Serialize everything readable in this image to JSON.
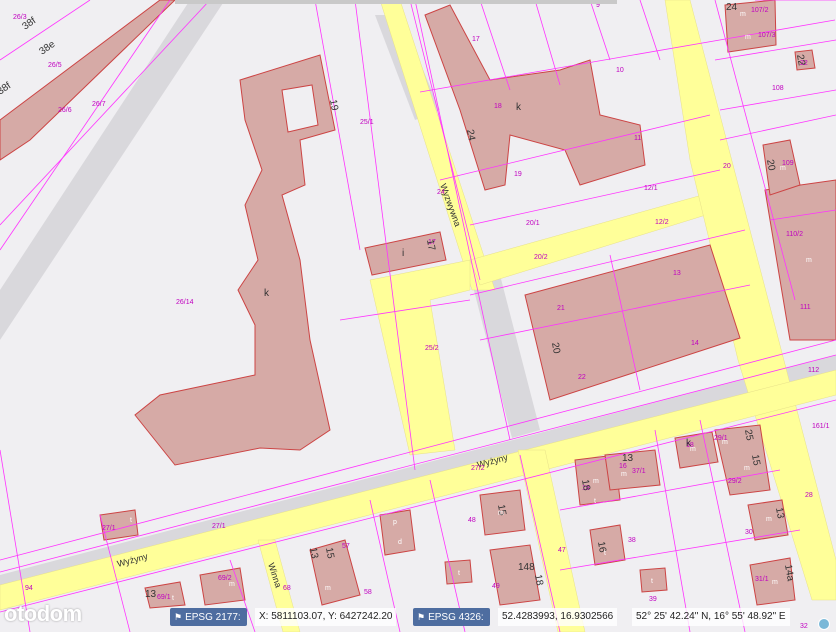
{
  "map": {
    "colors": {
      "background": "#f0eff2",
      "road": "#ffff99",
      "building": "#d6aaa6",
      "parcel_line": "#ff00ff",
      "building_outline": "#cc3333"
    },
    "streets": [
      {
        "id": "vertical",
        "name": "Wyzwywna"
      },
      {
        "id": "horizontal-1",
        "name": "Wyżyny"
      },
      {
        "id": "horizontal-2",
        "name": "Wyżyny"
      },
      {
        "id": "lower",
        "name": "Winna"
      }
    ],
    "parcel_labels": [
      "26/3",
      "26/5",
      "26/6",
      "26/7",
      "9",
      "17",
      "10",
      "107/2",
      "107/3",
      "22",
      "108",
      "11",
      "18",
      "19",
      "24",
      "109",
      "20",
      "25/1",
      "12/1",
      "12/2",
      "20/1",
      "20/2",
      "110/2",
      "111",
      "26/14",
      "17",
      "21",
      "13",
      "14",
      "25/2",
      "20",
      "22",
      "112",
      "161/1",
      "18",
      "29/1",
      "16",
      "37/1",
      "18",
      "29/2",
      "27/2",
      "28",
      "27/1",
      "48",
      "30",
      "47",
      "38",
      "94",
      "68",
      "57",
      "58",
      "69/2",
      "69/1",
      "49",
      "39",
      "31/1",
      "32"
    ],
    "building_labels": [
      "38f",
      "38e",
      "38f",
      "19",
      "k",
      "24",
      "18",
      "k",
      "24",
      "20",
      "22",
      "17",
      "i",
      "20",
      "25",
      "k",
      "15",
      "13",
      "18",
      "16",
      "15",
      "18",
      "13",
      "13",
      "15",
      "14a",
      "148",
      "13"
    ],
    "marks": [
      "m",
      "m",
      "m",
      "m",
      "m",
      "m",
      "m",
      "m",
      "t",
      "m",
      "m",
      "m",
      "m",
      "t",
      "m",
      "t",
      "t",
      "p",
      "d",
      "t",
      "m",
      "t"
    ]
  },
  "coord_bar": {
    "epsg1_label": "EPSG 2177:",
    "epsg1_value": "X: 5811103.07, Y: 6427242.20",
    "epsg2_label": "EPSG 4326:",
    "epsg2_value": "52.4283993, 16.9302566",
    "dms_value": "52° 25' 42.24\" N, 16° 55' 48.92\" E"
  },
  "logo": {
    "text": "otodom"
  },
  "icons": {
    "flag": "flag-icon",
    "map_button": "globe-icon"
  }
}
